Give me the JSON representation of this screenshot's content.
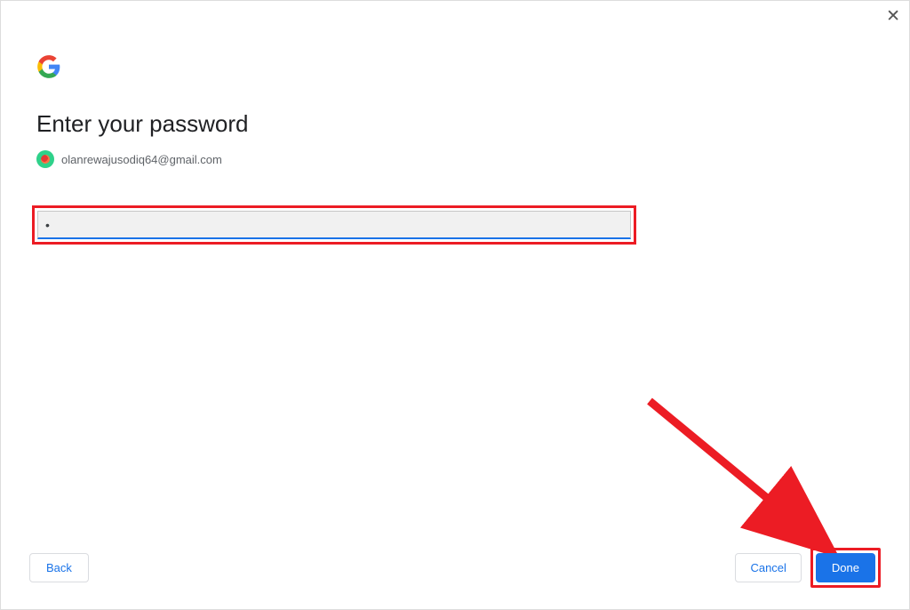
{
  "close_label": "✕",
  "title": "Enter your password",
  "account": {
    "email": "olanrewajusodiq64@gmail.com"
  },
  "password_input": {
    "value": "•"
  },
  "buttons": {
    "back": "Back",
    "cancel": "Cancel",
    "done": "Done"
  },
  "annotation": {
    "highlight_color": "#ec1c24"
  }
}
